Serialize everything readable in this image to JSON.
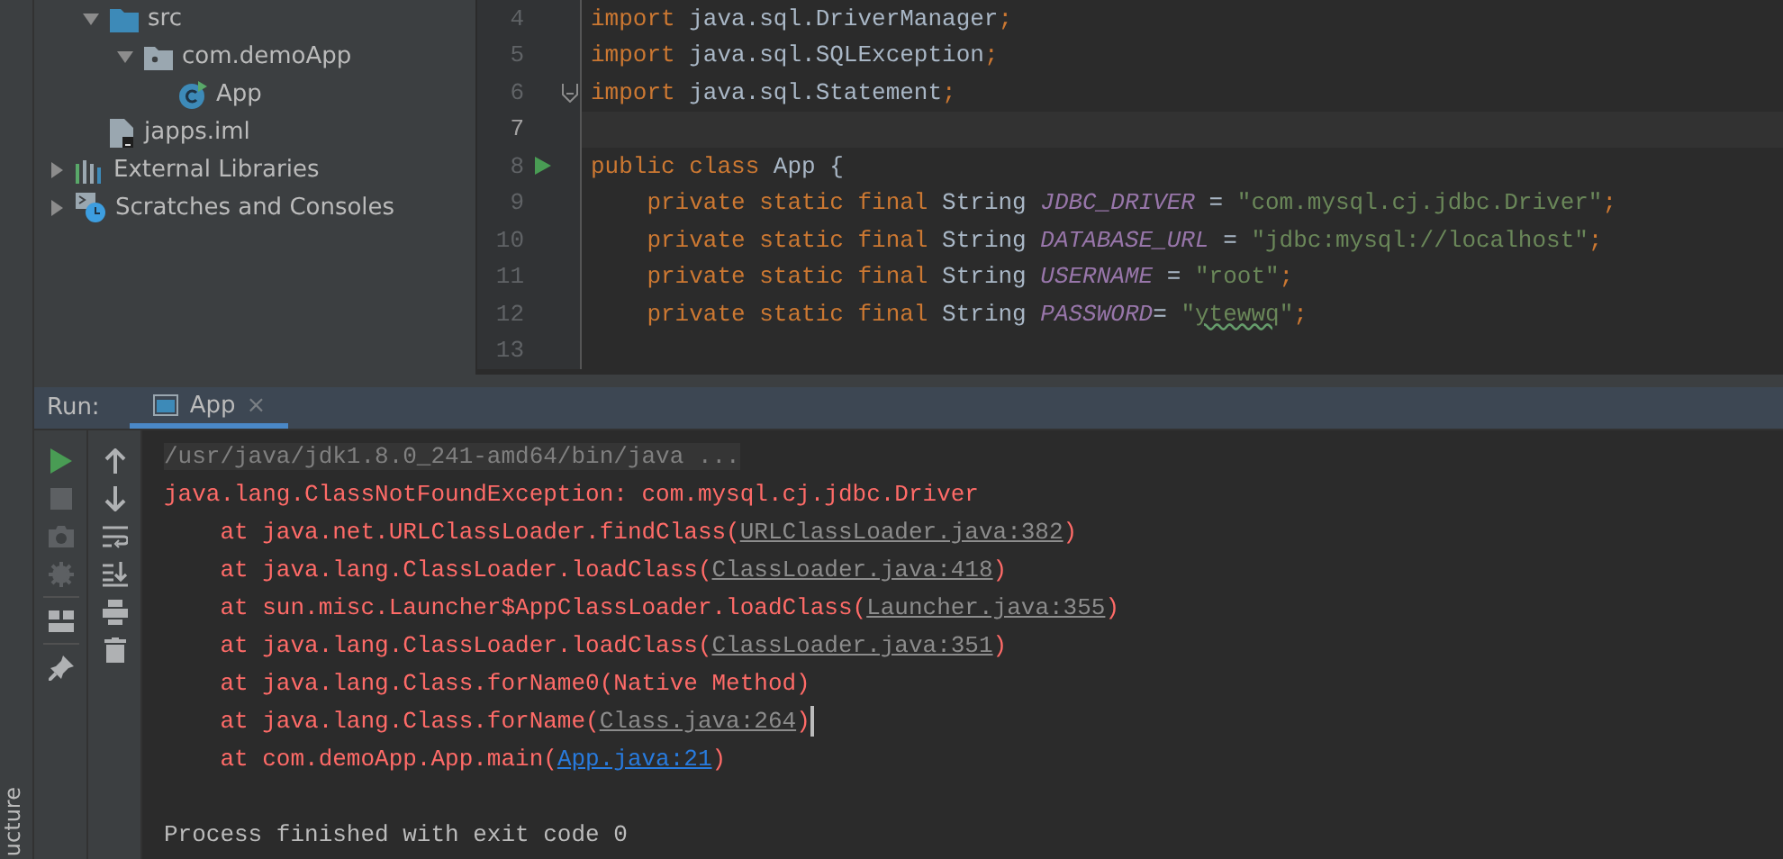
{
  "side_strip": {
    "label": "ucture"
  },
  "project_tree": [
    {
      "children": [
        {
          "label": "src",
          "kind": "folder",
          "expanded": true,
          "children": [
            {
              "label": "com.demoApp",
              "kind": "package",
              "expanded": true,
              "children": [
                {
                  "label": "App",
                  "kind": "class"
                }
              ]
            }
          ]
        },
        {
          "label": "japps.iml",
          "kind": "file"
        }
      ]
    },
    {
      "label": "External Libraries",
      "kind": "libraries",
      "expanded": false
    },
    {
      "label": "Scratches and Consoles",
      "kind": "scratches",
      "expanded": false
    }
  ],
  "editor": {
    "lines": [
      {
        "number": "4",
        "tokens": [
          {
            "kind": "keyword",
            "text": "import "
          },
          {
            "kind": "plain",
            "text": "java.sql.DriverManager"
          },
          {
            "kind": "keyword",
            "text": ";"
          }
        ]
      },
      {
        "number": "5",
        "tokens": [
          {
            "kind": "keyword",
            "text": "import "
          },
          {
            "kind": "plain",
            "text": "java.sql.SQLException"
          },
          {
            "kind": "keyword",
            "text": ";"
          }
        ]
      },
      {
        "number": "6",
        "fold": true,
        "tokens": [
          {
            "kind": "keyword",
            "text": "import "
          },
          {
            "kind": "plain",
            "text": "java.sql.Statement"
          },
          {
            "kind": "keyword",
            "text": ";"
          }
        ]
      },
      {
        "number": "7",
        "current": true
      },
      {
        "number": "8",
        "run": true,
        "tokens": [
          {
            "kind": "keyword",
            "text": "public class "
          },
          {
            "kind": "plain",
            "text": "App {"
          }
        ]
      },
      {
        "number": "9",
        "tokens": [
          {
            "kind": "keyword",
            "text": "    private static final "
          },
          {
            "kind": "plain",
            "text": "String "
          },
          {
            "kind": "constant",
            "text": "JDBC_DRIVER"
          },
          {
            "kind": "plain",
            "text": " = "
          },
          {
            "kind": "string",
            "text": "\"com.mysql.cj.jdbc.Driver\""
          },
          {
            "kind": "keyword",
            "text": ";"
          }
        ]
      },
      {
        "number": "10",
        "tokens": [
          {
            "kind": "keyword",
            "text": "    private static final "
          },
          {
            "kind": "plain",
            "text": "String "
          },
          {
            "kind": "constant",
            "text": "DATABASE_URL"
          },
          {
            "kind": "plain",
            "text": " = "
          },
          {
            "kind": "string",
            "text": "\"jdbc:mysql://localhost\""
          },
          {
            "kind": "keyword",
            "text": ";"
          }
        ]
      },
      {
        "number": "11",
        "tokens": [
          {
            "kind": "keyword",
            "text": "    private static final "
          },
          {
            "kind": "plain",
            "text": "String "
          },
          {
            "kind": "constant",
            "text": "USERNAME"
          },
          {
            "kind": "plain",
            "text": " = "
          },
          {
            "kind": "string",
            "text": "\"root\""
          },
          {
            "kind": "keyword",
            "text": ";"
          }
        ]
      },
      {
        "number": "12",
        "tokens": [
          {
            "kind": "keyword",
            "text": "    private static final "
          },
          {
            "kind": "plain",
            "text": "String "
          },
          {
            "kind": "constant",
            "text": "PASSWORD"
          },
          {
            "kind": "plain",
            "text": "= "
          },
          {
            "kind": "string",
            "text": "\""
          },
          {
            "kind": "typo",
            "text": "ytewwq"
          },
          {
            "kind": "string",
            "text": "\""
          },
          {
            "kind": "keyword",
            "text": ";"
          }
        ]
      },
      {
        "number": "13"
      }
    ]
  },
  "run_panel": {
    "label": "Run:",
    "tabs": [
      {
        "label": "App",
        "close": "×",
        "selected": true
      }
    ],
    "toolbar_left": [
      {
        "kind": "rerun",
        "disabled": false
      },
      {
        "kind": "stop",
        "disabled": true
      },
      {
        "kind": "camera",
        "disabled": true
      },
      {
        "kind": "debug-settings",
        "disabled": true
      },
      {
        "kind": "layout",
        "disabled": false
      },
      {
        "kind": "pin",
        "disabled": false
      }
    ],
    "toolbar_right": [
      {
        "kind": "up",
        "disabled": false
      },
      {
        "kind": "down",
        "disabled": false
      },
      {
        "kind": "wrap",
        "disabled": false
      },
      {
        "kind": "scroll-end",
        "disabled": false
      },
      {
        "kind": "print",
        "disabled": false
      },
      {
        "kind": "trash",
        "disabled": false
      }
    ],
    "console": [
      {
        "kind": "command",
        "tokens": [
          {
            "kind": "text",
            "text": "/usr/java/jdk1.8.0_241-amd64/bin/java ..."
          }
        ]
      },
      {
        "kind": "error",
        "tokens": [
          {
            "kind": "text",
            "text": "java.lang.ClassNotFoundException: com.mysql.cj.jdbc.Driver"
          }
        ]
      },
      {
        "kind": "error",
        "tokens": [
          {
            "kind": "text",
            "text": "    at java.net.URLClassLoader.findClass("
          },
          {
            "kind": "link",
            "text": "URLClassLoader.java:382"
          },
          {
            "kind": "text",
            "text": ")"
          }
        ]
      },
      {
        "kind": "error",
        "tokens": [
          {
            "kind": "text",
            "text": "    at java.lang.ClassLoader.loadClass("
          },
          {
            "kind": "link",
            "text": "ClassLoader.java:418"
          },
          {
            "kind": "text",
            "text": ")"
          }
        ]
      },
      {
        "kind": "error",
        "tokens": [
          {
            "kind": "text",
            "text": "    at sun.misc.Launcher$AppClassLoader.loadClass("
          },
          {
            "kind": "link",
            "text": "Launcher.java:355"
          },
          {
            "kind": "text",
            "text": ")"
          }
        ]
      },
      {
        "kind": "error",
        "tokens": [
          {
            "kind": "text",
            "text": "    at java.lang.ClassLoader.loadClass("
          },
          {
            "kind": "link",
            "text": "ClassLoader.java:351"
          },
          {
            "kind": "text",
            "text": ")"
          }
        ]
      },
      {
        "kind": "error",
        "tokens": [
          {
            "kind": "text",
            "text": "    at java.lang.Class.forName0(Native Method)"
          }
        ]
      },
      {
        "kind": "error",
        "cursor": true,
        "tokens": [
          {
            "kind": "text",
            "text": "    at java.lang.Class.forName("
          },
          {
            "kind": "link",
            "text": "Class.java:264"
          },
          {
            "kind": "text",
            "text": ")"
          }
        ]
      },
      {
        "kind": "error",
        "tokens": [
          {
            "kind": "text",
            "text": "    at com.demoApp.App.main("
          },
          {
            "kind": "user_link",
            "text": "App.java:21"
          },
          {
            "kind": "text",
            "text": ")"
          }
        ]
      },
      {
        "kind": "info",
        "tokens": [
          {
            "kind": "text",
            "text": "Process finished with exit code 0"
          }
        ]
      }
    ]
  }
}
